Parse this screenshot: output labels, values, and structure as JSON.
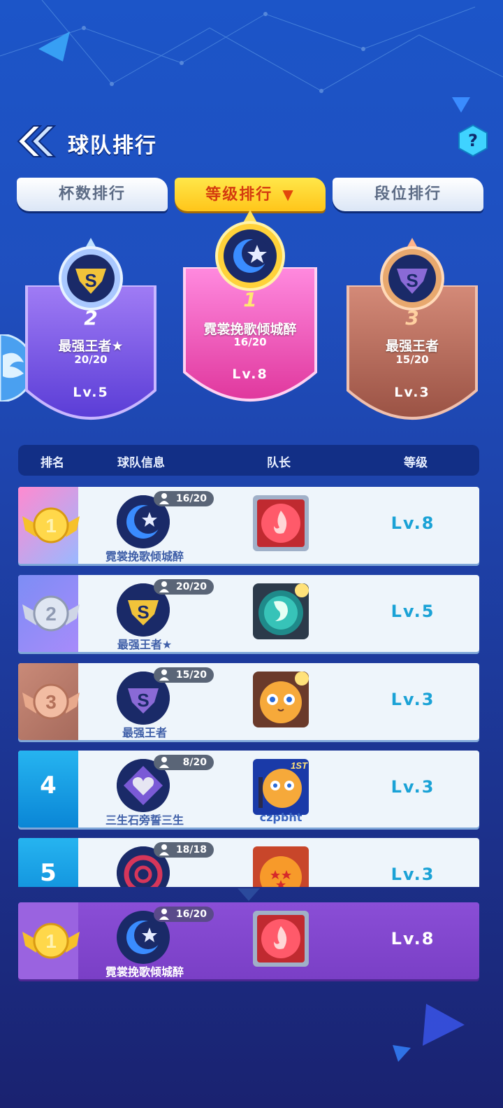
{
  "header": {
    "title": "球队排行",
    "help": "?"
  },
  "tabs": [
    {
      "label": "杯数排行",
      "active": false
    },
    {
      "label": "等级排行",
      "active": true,
      "caret": "▼"
    },
    {
      "label": "段位排行",
      "active": false
    }
  ],
  "podium": [
    {
      "rank": "2",
      "name": "最强王者★",
      "count": "20/20",
      "level": "Lv.5"
    },
    {
      "rank": "1",
      "name": "霓裳挽歌倾城醉",
      "count": "16/20",
      "level": "Lv.8"
    },
    {
      "rank": "3",
      "name": "最强王者",
      "count": "15/20",
      "level": "Lv.3"
    }
  ],
  "table": {
    "headers": [
      "排名",
      "球队信息",
      "队长",
      "等级"
    ],
    "rows": [
      {
        "rank": "1",
        "count": "16/20",
        "team": "霓裳挽歌倾城醉",
        "captain": "",
        "level": "Lv.8"
      },
      {
        "rank": "2",
        "count": "20/20",
        "team": "最强王者★",
        "captain": "",
        "level": "Lv.5"
      },
      {
        "rank": "3",
        "count": "15/20",
        "team": "最强王者",
        "captain": "",
        "level": "Lv.3"
      },
      {
        "rank": "4",
        "count": "8/20",
        "team": "三生石旁誓三生",
        "captain": "czpbht",
        "level": "Lv.3"
      },
      {
        "rank": "5",
        "count": "18/18",
        "team": "",
        "captain": "",
        "level": "Lv.3"
      }
    ]
  },
  "my_team": {
    "rank": "1",
    "count": "16/20",
    "team": "霓裳挽歌倾城醉",
    "level": "Lv.8"
  },
  "colors": {
    "accent_yellow": "#ffc51a",
    "level_text": "#1aa2d6",
    "my_row": "#7a3fc6"
  }
}
